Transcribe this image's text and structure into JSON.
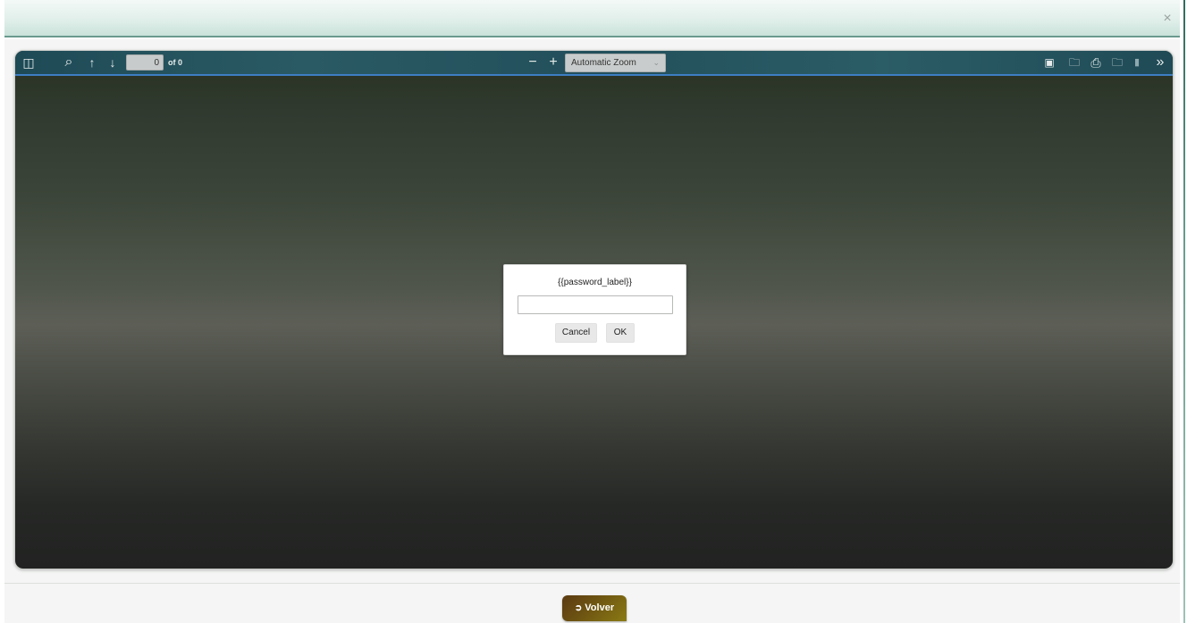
{
  "modal": {
    "close_icon": "×"
  },
  "toolbar": {
    "sidebar_icon": "◫",
    "search_icon": "⌕",
    "prev_icon": "↑",
    "next_icon": "↓",
    "page_number": "0",
    "page_count": "of 0",
    "zoom_out_icon": "−",
    "zoom_in_icon": "+",
    "zoom_value": "Automatic Zoom",
    "zoom_caret": "⌄",
    "presentation_icon": "▣",
    "open_icon": "🗀",
    "print_icon": "⎙",
    "download_icon": "🗀",
    "bookmark_icon": "▮",
    "tools_icon": "»"
  },
  "dialog": {
    "label": "{{password_label}}",
    "password_value": "",
    "cancel_label": "Cancel",
    "ok_label": "OK"
  },
  "footer": {
    "volver_icon": "➲",
    "volver_label": "Volver"
  },
  "colors": {
    "toolbar_accent": "#3d7ec4",
    "volver_button": "#6e5512"
  }
}
